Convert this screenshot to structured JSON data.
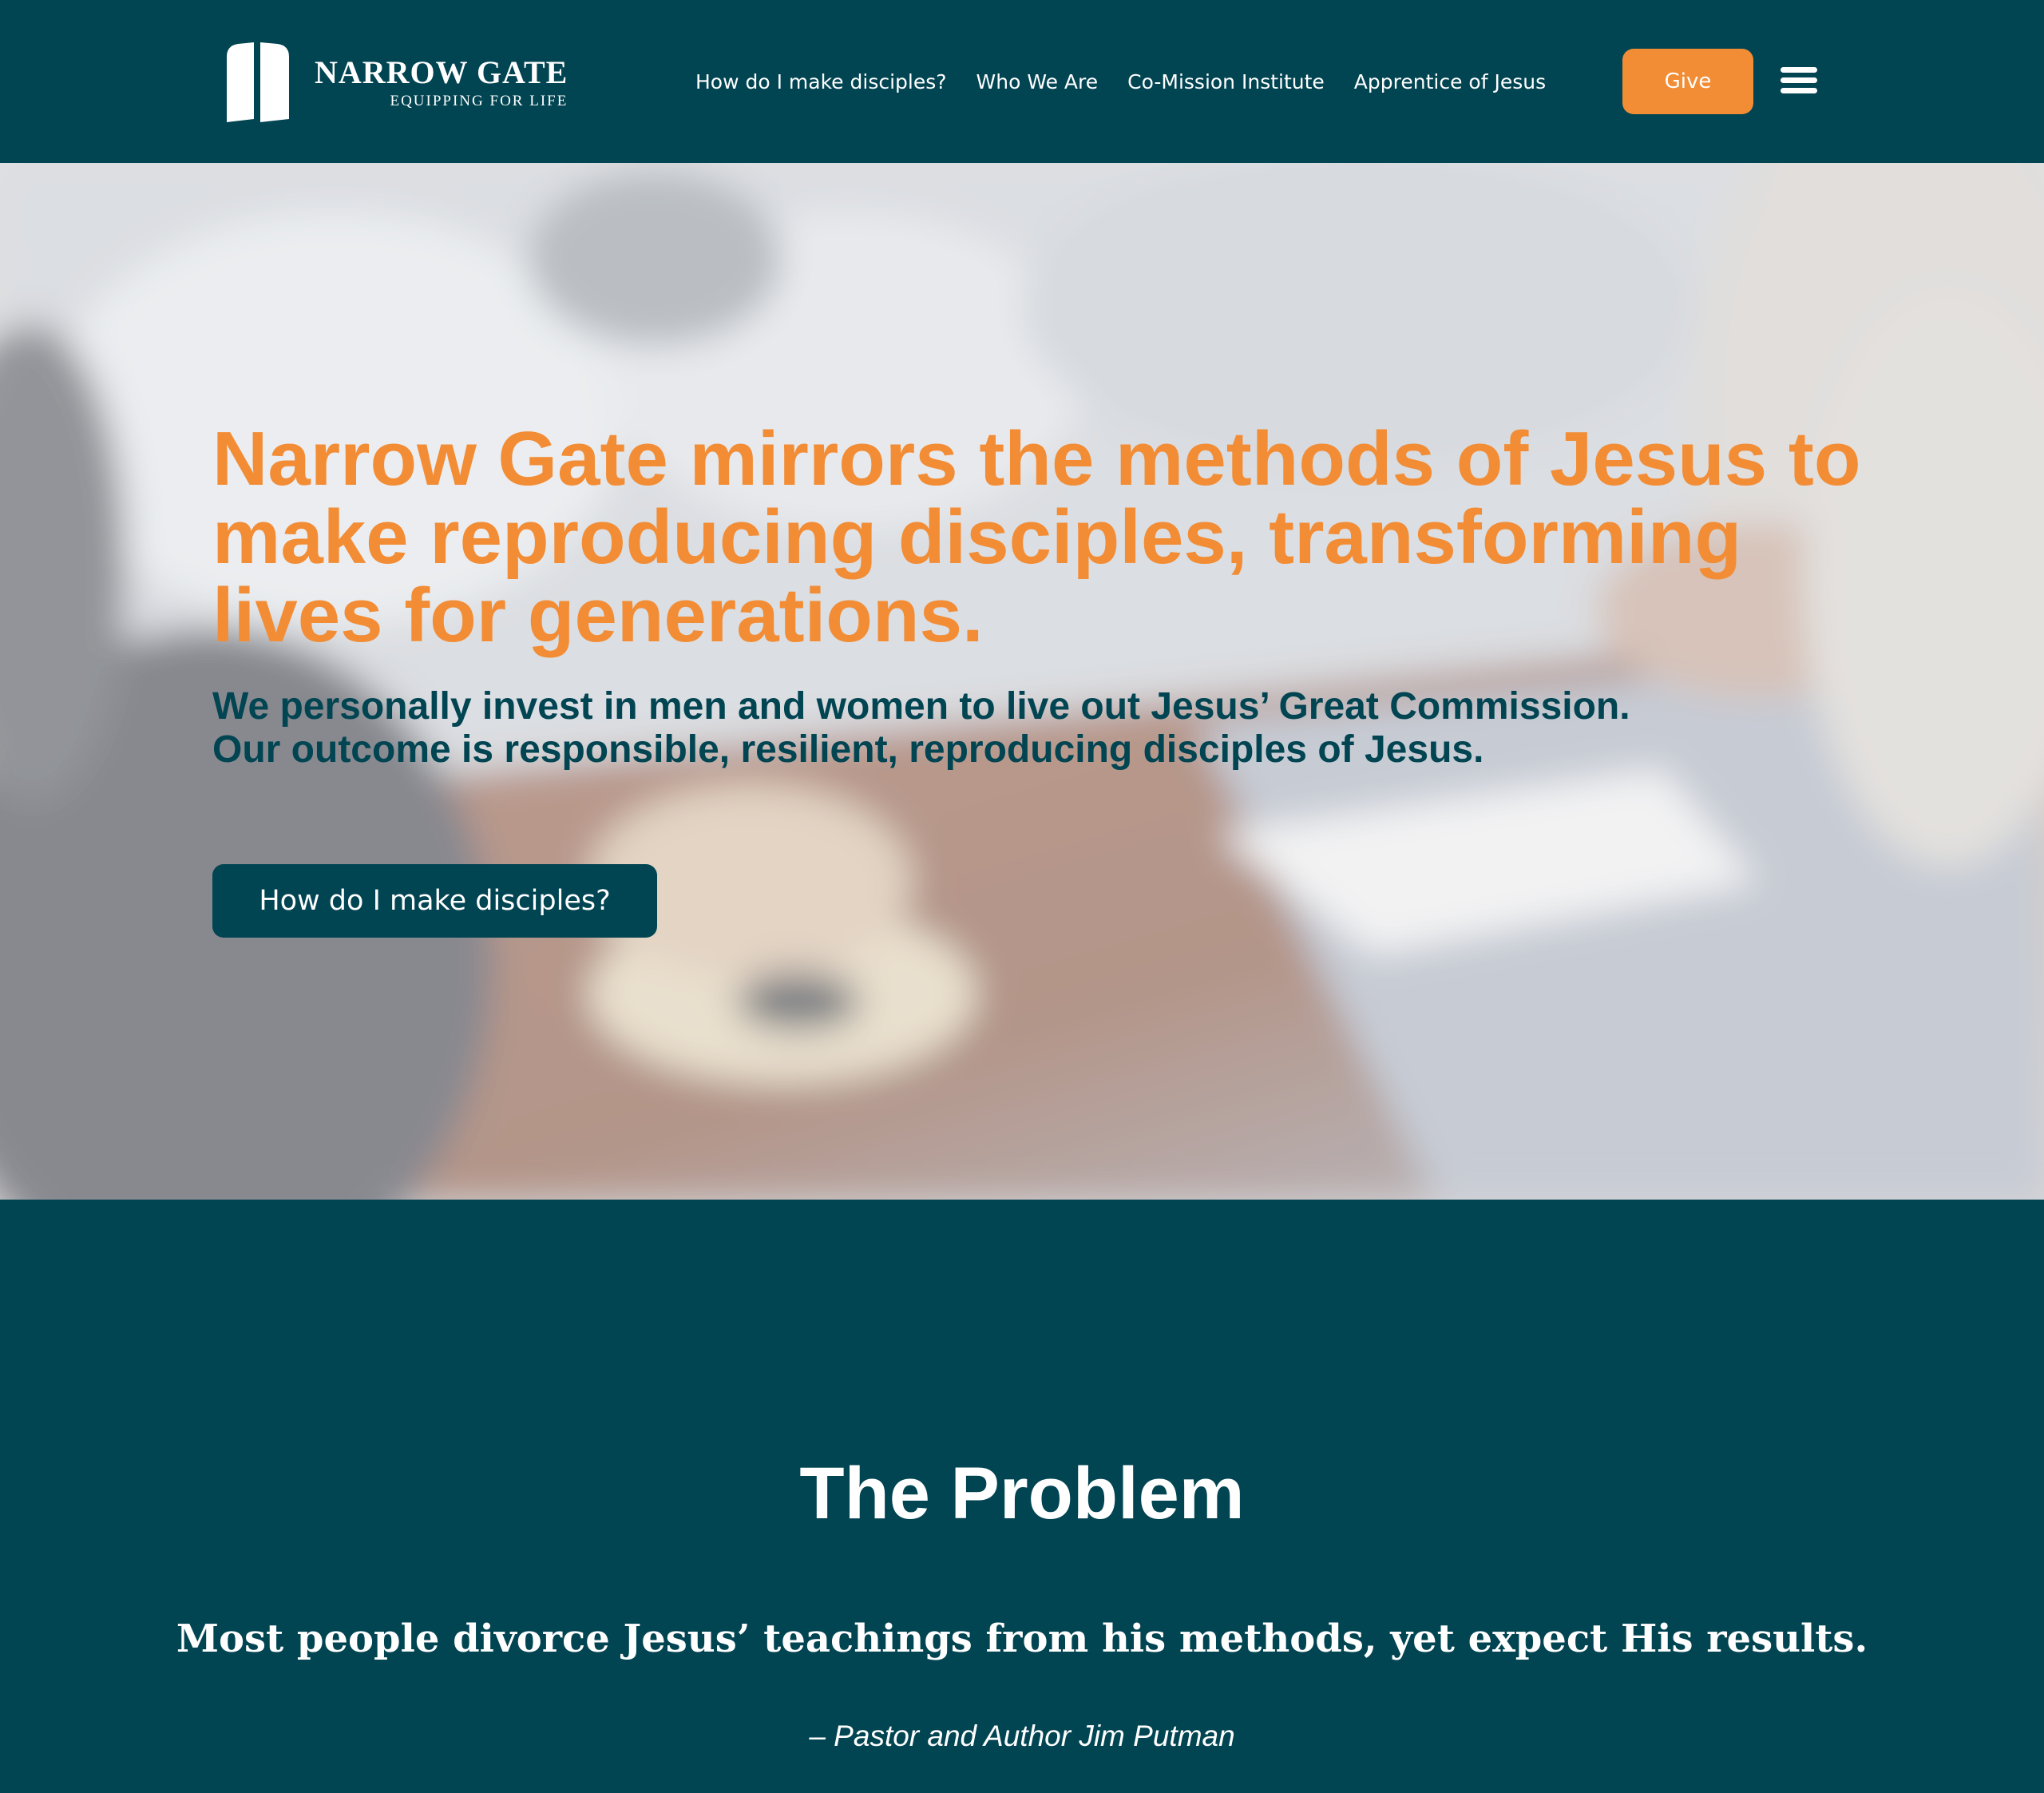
{
  "header": {
    "logo": {
      "name": "NARROW GATE",
      "tagline": "EQUIPPING FOR LIFE"
    },
    "nav": [
      {
        "label": "How do I make disciples?"
      },
      {
        "label": "Who We Are"
      },
      {
        "label": "Co-Mission Institute"
      },
      {
        "label": "Apprentice of Jesus"
      }
    ],
    "give_label": "Give",
    "menu_icon": "hamburger-menu-icon"
  },
  "hero": {
    "heading": "Narrow Gate mirrors the methods of Jesus to make reproducing disciples, transforming lives for generations.",
    "subheading": [
      "We personally invest in men and women to live out Jesus’ Great Commission.",
      "Our outcome is responsible, resilient, reproducing disciples of Jesus."
    ],
    "cta_label": "How do I make disciples?"
  },
  "problem": {
    "title": "The Problem",
    "quote": "Most people divorce Jesus’ teachings from his methods, yet expect His results.",
    "attribution": "– Pastor and Author Jim Putman"
  },
  "colors": {
    "brand_dark": "#014452",
    "accent_orange": "#f28d36",
    "text_light": "#ffffff"
  }
}
